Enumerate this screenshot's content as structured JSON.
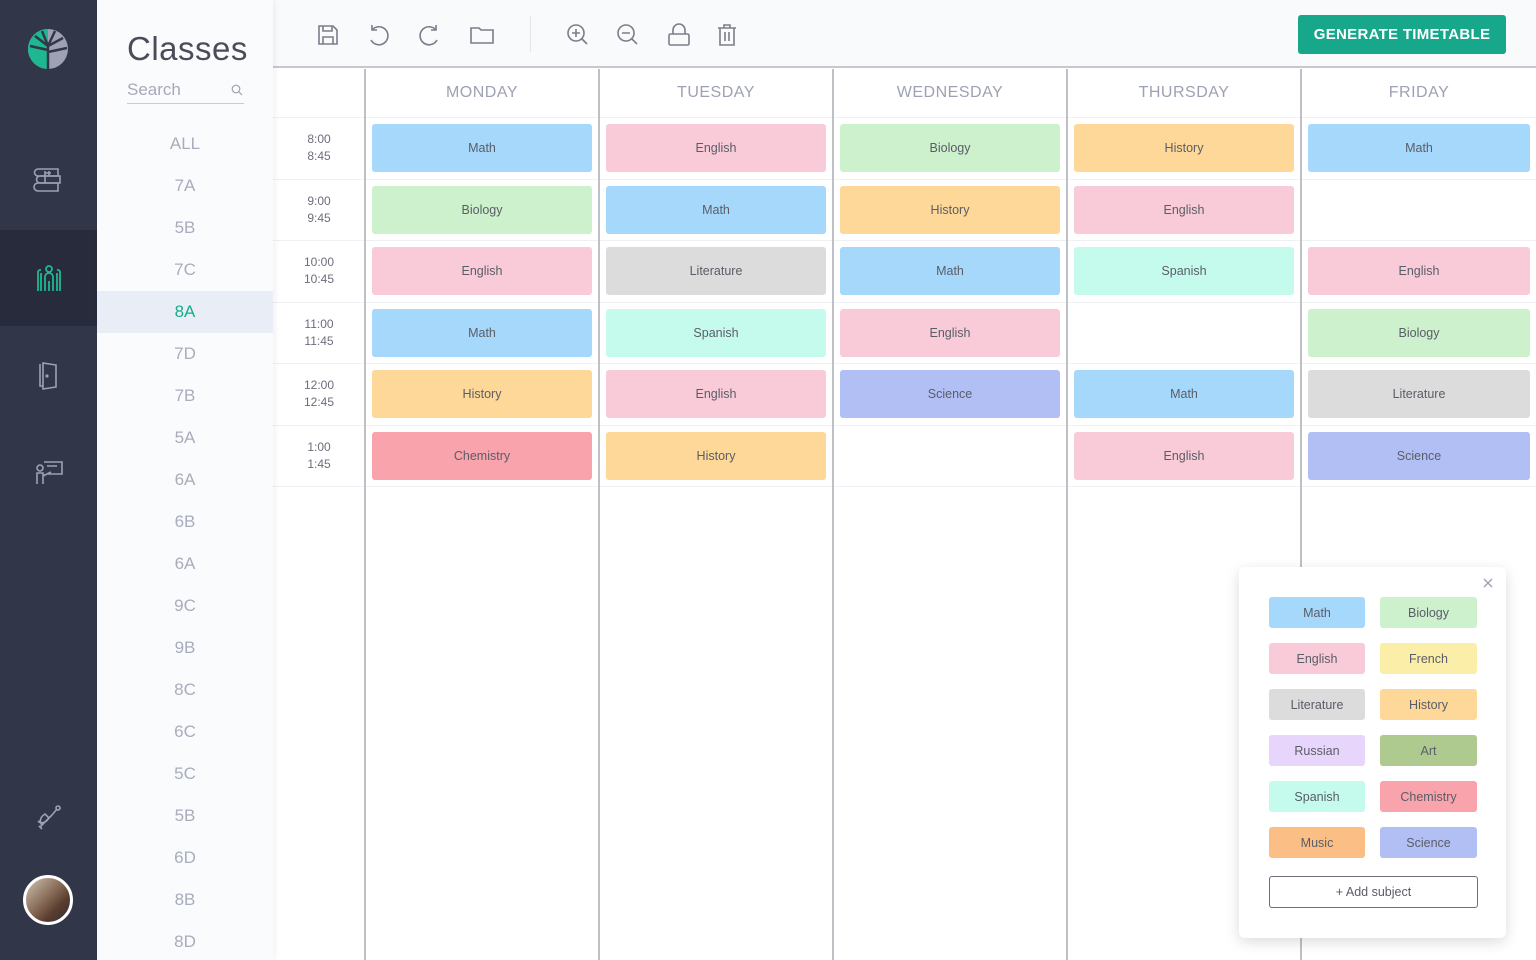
{
  "app": {
    "logo_icon": "tree-logo-icon",
    "accent_color": "#17a88c"
  },
  "rail": {
    "items": [
      {
        "name": "subjects",
        "icon": "books-icon",
        "active": false
      },
      {
        "name": "classes",
        "icon": "group-icon",
        "active": true
      },
      {
        "name": "rooms",
        "icon": "door-icon",
        "active": false
      },
      {
        "name": "teachers",
        "icon": "teacher-board-icon",
        "active": false
      }
    ],
    "bell_icon": "bell-icon",
    "avatar": "user-avatar"
  },
  "classes_panel": {
    "title": "Classes",
    "search_placeholder": "Search",
    "search_value": "",
    "items": [
      "ALL",
      "7A",
      "5B",
      "7C",
      "8A",
      "7D",
      "7B",
      "5A",
      "6A",
      "6B",
      "6A",
      "9C",
      "9B",
      "8C",
      "6C",
      "5C",
      "5B",
      "6D",
      "8B",
      "8D"
    ],
    "selected": "8A"
  },
  "toolbar": {
    "buttons": [
      {
        "name": "save",
        "icon": "save-icon"
      },
      {
        "name": "undo",
        "icon": "undo-icon"
      },
      {
        "name": "redo",
        "icon": "redo-icon"
      },
      {
        "name": "open",
        "icon": "folder-icon"
      },
      {
        "name": "zoom-in",
        "icon": "zoom-in-icon"
      },
      {
        "name": "zoom-out",
        "icon": "zoom-out-icon"
      },
      {
        "name": "lock",
        "icon": "lock-icon"
      },
      {
        "name": "delete",
        "icon": "trash-icon"
      }
    ],
    "generate_label": "GENERATE TIMETABLE"
  },
  "subject_colors": {
    "Math": "#a6d8fc",
    "Biology": "#cdf0cd",
    "English": "#f9cbd8",
    "French": "#fbeea8",
    "Literature": "#dcdcdc",
    "History": "#fed898",
    "Russian": "#e8d5fb",
    "Art": "#afca8f",
    "Spanish": "#c5fbed",
    "Chemistry": "#f9a3ad",
    "Music": "#fbbf86",
    "Science": "#b2bff5"
  },
  "timetable": {
    "days": [
      "MONDAY",
      "TUESDAY",
      "WEDNESDAY",
      "THURSDAY",
      "FRIDAY"
    ],
    "periods": [
      {
        "start": "8:00",
        "end": "8:45"
      },
      {
        "start": "9:00",
        "end": "9:45"
      },
      {
        "start": "10:00",
        "end": "10:45"
      },
      {
        "start": "11:00",
        "end": "11:45"
      },
      {
        "start": "12:00",
        "end": "12:45"
      },
      {
        "start": "1:00",
        "end": "1:45"
      }
    ],
    "lessons": [
      [
        "Math",
        "Biology",
        "English",
        "Math",
        "History",
        "Chemistry"
      ],
      [
        "English",
        "Math",
        "Literature",
        "Spanish",
        "English",
        "History"
      ],
      [
        "Biology",
        "History",
        "Math",
        "English",
        "Science",
        ""
      ],
      [
        "History",
        "English",
        "Spanish",
        "",
        "Math",
        "English"
      ],
      [
        "Math",
        "",
        "English",
        "Biology",
        "Literature",
        "Science"
      ]
    ]
  },
  "palette": {
    "close_icon": "close-icon",
    "subjects": [
      "Math",
      "Biology",
      "English",
      "French",
      "Literature",
      "History",
      "Russian",
      "Art",
      "Spanish",
      "Chemistry",
      "Music",
      "Science"
    ],
    "add_label": "+ Add subject"
  }
}
